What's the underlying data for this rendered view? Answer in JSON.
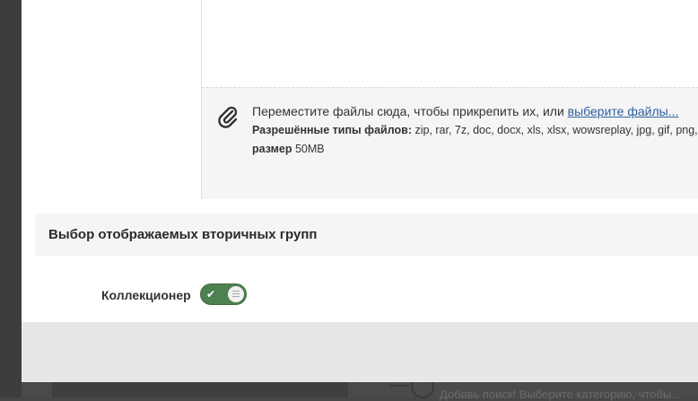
{
  "attachments": {
    "drop_text": "Переместите файлы сюда, чтобы прикрепить их, или ",
    "select_link": "выберите файлы...",
    "allowed_label": "Разрешённые типы файлов:",
    "allowed_types": " zip, rar, 7z, doc, docx, xls, xlsx, wowsreplay, jpg, gif, png,",
    "size_label": "размер",
    "size_value": " 50MB",
    "icon": "paperclip-icon"
  },
  "secondary_groups": {
    "title": "Выбор отображаемых вторичных групп",
    "items": [
      {
        "label": "Коллекционер",
        "enabled": true
      }
    ]
  },
  "background": {
    "ghost_text": "Добавь поиск! Выберите категорию, чтобы..."
  },
  "colors": {
    "toggle_on": "#4e8152",
    "link": "#2f5f9e",
    "footer": "#e6e7e9",
    "overlay": "#474747"
  }
}
